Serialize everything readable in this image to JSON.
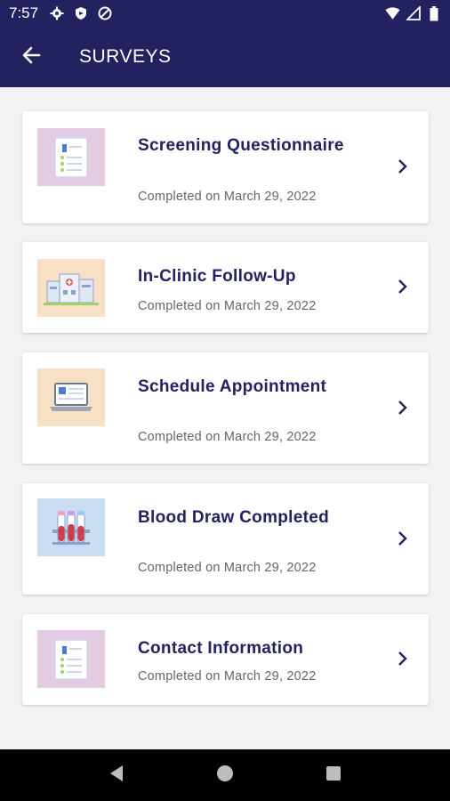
{
  "status_bar": {
    "time": "7:57",
    "left_icons": [
      "gear-icon",
      "shield-icon",
      "at-sign-icon"
    ],
    "right_icons": [
      "wifi-icon",
      "signal-icon",
      "battery-icon"
    ]
  },
  "app_bar": {
    "title": "SURVEYS",
    "back_icon": "arrow-left-icon",
    "background": "#23215f"
  },
  "surveys": [
    {
      "title": "Screening Questionnaire",
      "status": "Completed on March 29, 2022",
      "thumbnail": "document-icon",
      "thumb_bg": "#e3cbe3"
    },
    {
      "title": "In-Clinic Follow-Up",
      "status": "Completed on March 29, 2022",
      "thumbnail": "clinic-building-icon",
      "thumb_bg": "#f8e0c6"
    },
    {
      "title": "Schedule Appointment",
      "status": "Completed on March 29, 2022",
      "thumbnail": "laptop-icon",
      "thumb_bg": "#f8e0c6"
    },
    {
      "title": "Blood Draw Completed",
      "status": "Completed on March 29, 2022",
      "thumbnail": "test-tubes-icon",
      "thumb_bg": "#c9dcf2"
    },
    {
      "title": "Contact Information",
      "status": "Completed on March 29, 2022",
      "thumbnail": "document-icon",
      "thumb_bg": "#e3cbe3"
    }
  ],
  "nav_bar": {
    "buttons": [
      "back-triangle-icon",
      "home-circle-icon",
      "recents-square-icon"
    ]
  },
  "colors": {
    "primary": "#23215f",
    "card_title": "#23215f",
    "subtitle": "#666666"
  }
}
